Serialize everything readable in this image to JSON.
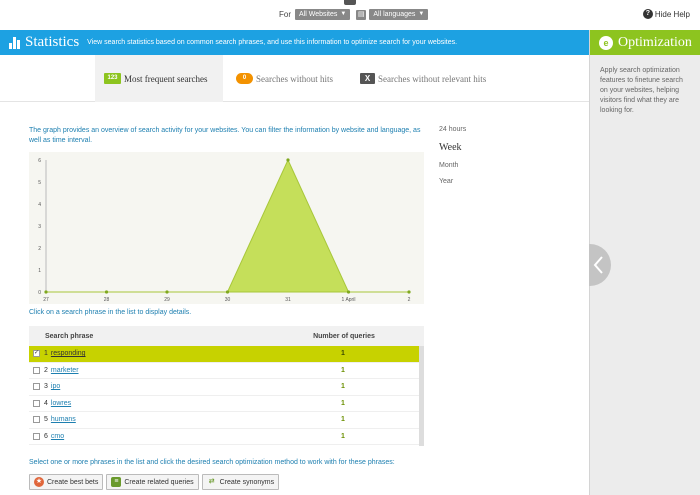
{
  "filters": {
    "for_label": "For",
    "website": "All Websites",
    "language": "All languages"
  },
  "help": {
    "hide_label": "Hide Help"
  },
  "header": {
    "title": "Statistics",
    "description": "View search statistics based on common search phrases, and use this information to optimize search for your websites."
  },
  "optimization": {
    "title": "Optimization",
    "description": "Apply search optimization features to finetune search on your websites, helping visitors find what they are looking for."
  },
  "tabs": [
    {
      "label": "Most frequent searches",
      "icon": "123",
      "active": true
    },
    {
      "label": "Searches without hits",
      "icon": "0",
      "active": false
    },
    {
      "label": "Searches without relevant hits",
      "icon": "X",
      "active": false
    }
  ],
  "intro": "The graph provides an overview of search activity for your websites. You can filter the information by website and language, as well as time interval.",
  "time_range": {
    "options": [
      "24 hours",
      "Week",
      "Month",
      "Year"
    ],
    "selected": "Week"
  },
  "chart_data": {
    "type": "area",
    "x": [
      "27",
      "28",
      "29",
      "30",
      "31",
      "1 April",
      "2"
    ],
    "y": [
      0,
      0,
      0,
      0,
      6,
      0,
      0
    ],
    "yticks": [
      "0",
      "1",
      "2",
      "3",
      "4",
      "5",
      "6"
    ],
    "ylim": [
      0,
      6
    ],
    "color": "#c5df5a",
    "grid": false
  },
  "click_hint": "Click on a search phrase in the list to display details.",
  "table": {
    "headers": [
      "Search phrase",
      "Number of queries"
    ],
    "rows": [
      {
        "n": "1",
        "phrase": "responding",
        "count": "1",
        "selected": true
      },
      {
        "n": "2",
        "phrase": "marketer",
        "count": "1",
        "selected": false
      },
      {
        "n": "3",
        "phrase": "ipo",
        "count": "1",
        "selected": false
      },
      {
        "n": "4",
        "phrase": "lowres",
        "count": "1",
        "selected": false
      },
      {
        "n": "5",
        "phrase": "humans",
        "count": "1",
        "selected": false
      },
      {
        "n": "6",
        "phrase": "cmo",
        "count": "1",
        "selected": false
      }
    ]
  },
  "select_hint": "Select one or more phrases in the list and click the desired search optimization method to work with for these phrases:",
  "actions": [
    "Create best bets",
    "Create related queries",
    "Create synonyms"
  ],
  "colors": {
    "accent_blue": "#1da1e2",
    "accent_green": "#8dc41f",
    "row_highlight": "#c7d200"
  }
}
